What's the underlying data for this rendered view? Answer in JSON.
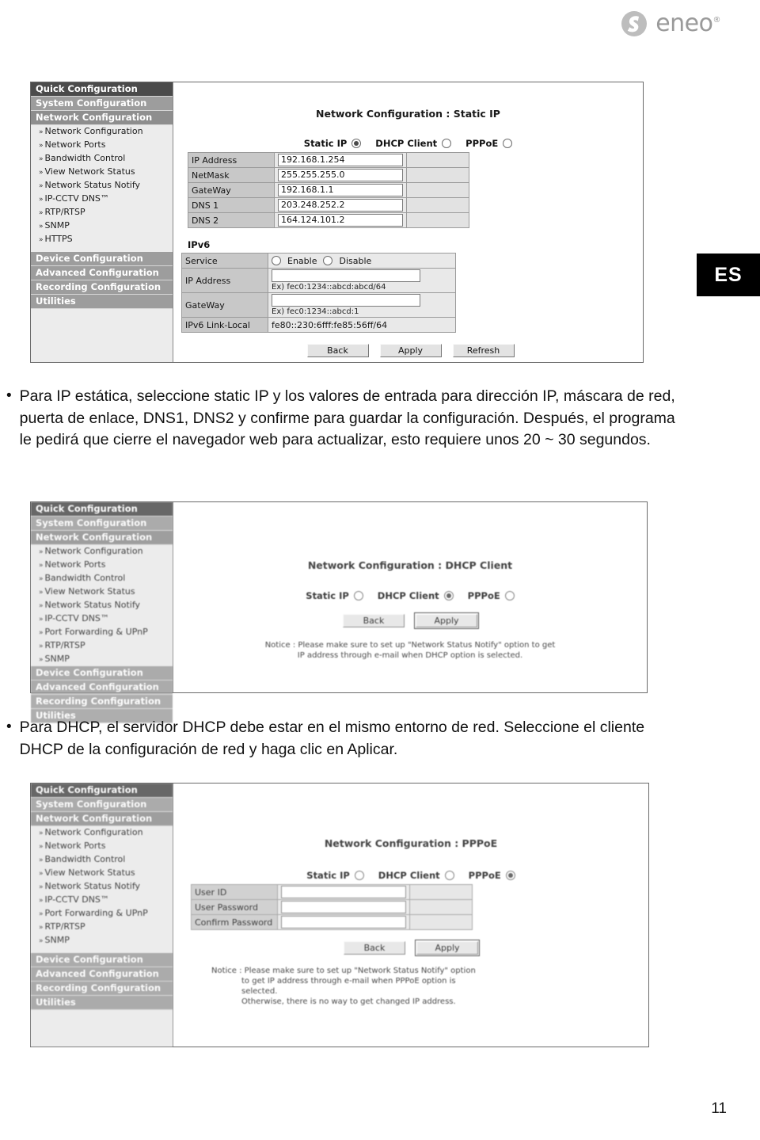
{
  "brand": {
    "logo_text": "eneo",
    "logo_registered": "®",
    "logo_icon": "eneo-swoosh-logo"
  },
  "language_badge": "ES",
  "page_number": "11",
  "sidebar_static": {
    "headers": [
      {
        "label": "Quick Configuration",
        "style": "dark"
      },
      {
        "label": "System Configuration",
        "style": "mid"
      },
      {
        "label": "Network Configuration",
        "style": "mid2"
      }
    ],
    "items": [
      "Network Configuration",
      "Network Ports",
      "Bandwidth Control",
      "View Network Status",
      "Network Status Notify",
      "IP-CCTV DNS™",
      "RTP/RTSP",
      "SNMP",
      "HTTPS"
    ],
    "footers": [
      "Device Configuration",
      "Advanced Configuration",
      "Recording Configuration",
      "Utilities"
    ],
    "chevron": "»"
  },
  "sidebar_alt": {
    "headers": [
      {
        "label": "Quick Configuration",
        "style": "dark"
      },
      {
        "label": "System Configuration",
        "style": "mid"
      },
      {
        "label": "Network Configuration",
        "style": "mid2"
      }
    ],
    "items": [
      "Network Configuration",
      "Network Ports",
      "Bandwidth Control",
      "View Network Status",
      "Network Status Notify",
      "IP-CCTV DNS™",
      "Port Forwarding & UPnP",
      "RTP/RTSP",
      "SNMP"
    ],
    "footers": [
      "Device Configuration",
      "Advanced Configuration",
      "Recording Configuration",
      "Utilities"
    ],
    "chevron": "»"
  },
  "screenshot_static": {
    "title": "Network Configuration : Static IP",
    "modes": [
      {
        "label": "Static IP",
        "selected": true
      },
      {
        "label": "DHCP Client",
        "selected": false
      },
      {
        "label": "PPPoE",
        "selected": false
      }
    ],
    "fields": [
      {
        "label": "IP Address",
        "value": "192.168.1.254"
      },
      {
        "label": "NetMask",
        "value": "255.255.255.0"
      },
      {
        "label": "GateWay",
        "value": "192.168.1.1"
      },
      {
        "label": "DNS 1",
        "value": "203.248.252.2"
      },
      {
        "label": "DNS 2",
        "value": "164.124.101.2"
      }
    ],
    "ipv6_heading": "IPv6",
    "ipv6_service_label": "Service",
    "ipv6_service_options": [
      {
        "label": "Enable",
        "selected": false
      },
      {
        "label": "Disable",
        "selected": false
      }
    ],
    "ipv6_ip_label": "IP Address",
    "ipv6_ip_value": "",
    "ipv6_ip_hint": "Ex) fec0:1234::abcd:abcd/64",
    "ipv6_gw_label": "GateWay",
    "ipv6_gw_value": "",
    "ipv6_gw_hint": "Ex) fec0:1234::abcd:1",
    "ipv6_linklocal_label": "IPv6 Link-Local",
    "ipv6_linklocal_value": "fe80::230:6fff:fe85:56ff/64",
    "buttons": [
      "Back",
      "Apply",
      "Refresh"
    ]
  },
  "screenshot_dhcp": {
    "title": "Network Configuration : DHCP Client",
    "modes": [
      {
        "label": "Static IP",
        "selected": false
      },
      {
        "label": "DHCP Client",
        "selected": true
      },
      {
        "label": "PPPoE",
        "selected": false
      }
    ],
    "buttons": [
      "Back",
      "Apply"
    ],
    "notice_lines": [
      "Notice : Please make sure to set up \"Network Status Notify\" option to get",
      "IP address through e-mail when DHCP option is selected."
    ]
  },
  "screenshot_pppoe": {
    "title": "Network Configuration : PPPoE",
    "modes": [
      {
        "label": "Static IP",
        "selected": false
      },
      {
        "label": "DHCP Client",
        "selected": false
      },
      {
        "label": "PPPoE",
        "selected": true
      }
    ],
    "fields": [
      {
        "label": "User ID",
        "value": ""
      },
      {
        "label": "User Password",
        "value": ""
      },
      {
        "label": "Confirm Password",
        "value": ""
      }
    ],
    "buttons": [
      "Back",
      "Apply"
    ],
    "notice_lines": [
      "Notice : Please make sure to set up \"Network Status Notify\" option",
      "to get IP address through e-mail when PPPoE option is",
      "selected.",
      "Otherwise, there is no way to get changed IP address."
    ]
  },
  "body": {
    "bullet_glyph": "•",
    "paragraph_1": "Para IP estática, seleccione static IP y los valores de entrada para dirección IP, máscara de red, puerta de enlace, DNS1, DNS2 y confirme para guardar la configuración. Después, el programa le pedirá que cierre el navegador web para actualizar, esto requiere unos 20 ~ 30 segundos.",
    "paragraph_2": "Para DHCP, el servidor DHCP debe estar en el mismo entorno de red. Seleccione el cliente DHCP de la configuración de red y haga clic en Aplicar."
  },
  "colors": {
    "nav_dark": "#4b4b4b",
    "nav_mid": "#9d9d9d",
    "panel_bg": "#ececec",
    "label_cell": "#c8c8c8",
    "badge_bg": "#000000"
  }
}
